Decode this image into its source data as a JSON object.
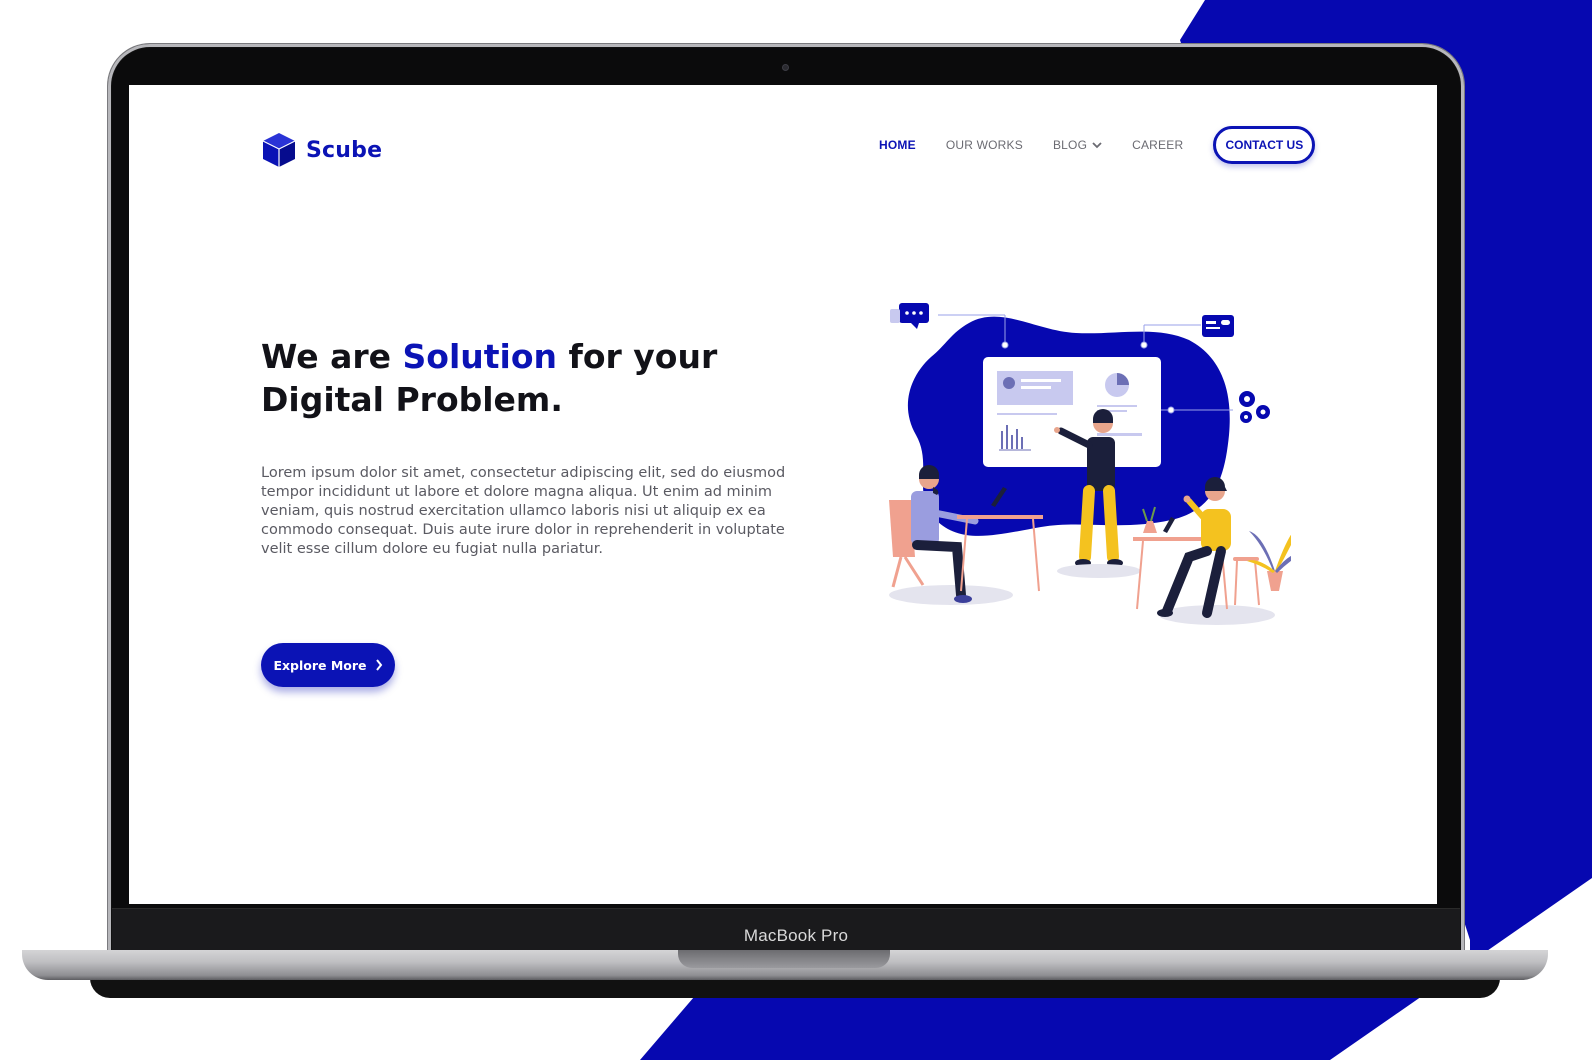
{
  "device": {
    "label": "MacBook Pro"
  },
  "colors": {
    "brand": "#0b13b5",
    "text_dark": "#121218",
    "text_muted": "#5a5a62",
    "accent_yellow": "#f4c21f",
    "chair": "#f0a18f"
  },
  "site": {
    "logo": {
      "text": "Scube",
      "icon": "cube-icon"
    },
    "nav": {
      "items": [
        {
          "label": "HOME",
          "active": true
        },
        {
          "label": "OUR WORKS",
          "active": false
        },
        {
          "label": "BLOG",
          "active": false,
          "icon": "chevron-down-icon"
        },
        {
          "label": "CAREER",
          "active": false
        }
      ],
      "cta": "CONTACT US"
    },
    "hero": {
      "title_part1": "We are ",
      "title_accent": "Solution",
      "title_part2": " for your Digital Problem.",
      "description": "Lorem ipsum dolor sit amet, consectetur adipiscing elit, sed do eiusmod tempor incididunt ut labore et dolore magna aliqua. Ut enim ad minim veniam, quis nostrud exercitation ullamco laboris nisi ut aliquip ex ea commodo consequat. Duis aute irure dolor in reprehenderit in voluptate velit esse cillum dolore eu fugiat nulla pariatur.",
      "button": "Explore More",
      "button_icon": "chevron-right-icon"
    }
  }
}
